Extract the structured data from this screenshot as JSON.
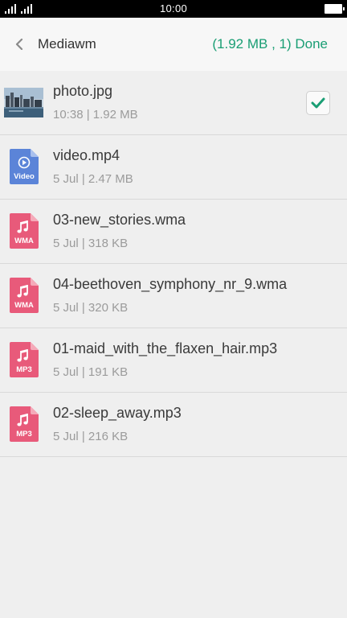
{
  "status_bar": {
    "time": "10:00"
  },
  "header": {
    "title": "Mediawm",
    "done_label": "(1.92 MB , 1) Done"
  },
  "colors": {
    "accent": "#1a9e74",
    "video_icon": "#5b84d8",
    "audio_icon": "#e85a7a"
  },
  "files": [
    {
      "name": "photo.jpg",
      "meta": "10:38 | 1.92 MB",
      "icon": "photo-thumbnail",
      "checked": true
    },
    {
      "name": "video.mp4",
      "meta": "5 Jul | 2.47 MB",
      "icon": "video-file-icon",
      "badge": "Video"
    },
    {
      "name": "03-new_stories.wma",
      "meta": "5 Jul | 318 KB",
      "icon": "music-file-icon",
      "badge": "WMA"
    },
    {
      "name": "04-beethoven_symphony_nr_9.wma",
      "meta": "5 Jul | 320 KB",
      "icon": "music-file-icon",
      "badge": "WMA"
    },
    {
      "name": "01-maid_with_the_flaxen_hair.mp3",
      "meta": "5 Jul | 191 KB",
      "icon": "music-file-icon",
      "badge": "MP3"
    },
    {
      "name": "02-sleep_away.mp3",
      "meta": "5 Jul | 216 KB",
      "icon": "music-file-icon",
      "badge": "MP3"
    }
  ]
}
